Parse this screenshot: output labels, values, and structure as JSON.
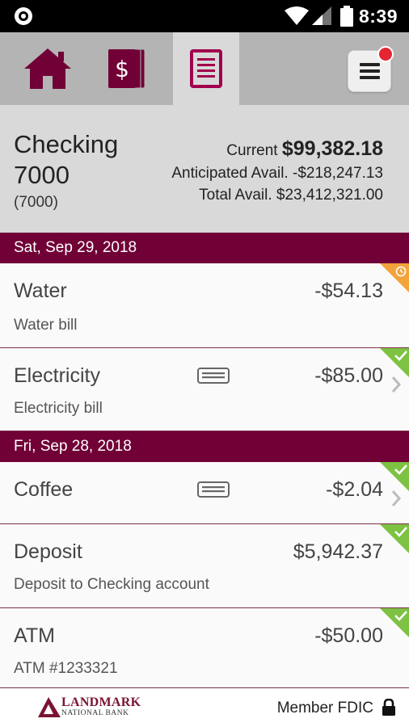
{
  "status_bar": {
    "time": "8:39"
  },
  "nav": {
    "tabs": [
      {
        "icon": "home-icon",
        "active": false
      },
      {
        "icon": "accounts-icon",
        "active": false
      },
      {
        "icon": "transactions-icon",
        "active": true
      }
    ],
    "menu_icon": "hamburger-menu-icon"
  },
  "account": {
    "name": "Checking 7000",
    "number": "(7000)",
    "current_label": "Current",
    "current_value": "$99,382.18",
    "anticipated_label": "Anticipated Avail.",
    "anticipated_value": "-$218,247.13",
    "total_label": "Total Avail.",
    "total_value": "$23,412,321.00"
  },
  "groups": [
    {
      "date": "Sat, Sep 29, 2018",
      "transactions": [
        {
          "title": "Water",
          "amount": "-$54.13",
          "description": "Water bill",
          "status": "pending",
          "has_card": false,
          "has_chevron": false
        },
        {
          "title": "Electricity",
          "amount": "-$85.00",
          "description": "Electricity bill",
          "status": "cleared",
          "has_card": true,
          "has_chevron": true
        }
      ]
    },
    {
      "date": "Fri, Sep 28, 2018",
      "transactions": [
        {
          "title": "Coffee",
          "amount": "-$2.04",
          "description": "",
          "status": "cleared",
          "has_card": true,
          "has_chevron": true
        },
        {
          "title": "Deposit",
          "amount": "$5,942.37",
          "description": "Deposit to Checking account",
          "status": "cleared",
          "has_card": false,
          "has_chevron": false
        },
        {
          "title": "ATM",
          "amount": "-$50.00",
          "description": "ATM #1233321",
          "status": "cleared",
          "has_card": false,
          "has_chevron": false
        }
      ]
    }
  ],
  "footer": {
    "logo_line1": "LANDMARK",
    "logo_line2": "NATIONAL BANK",
    "member_text": "Member FDIC"
  },
  "colors": {
    "brand": "#700036",
    "status_pending": "#f2a33a",
    "status_cleared": "#7dc242"
  }
}
